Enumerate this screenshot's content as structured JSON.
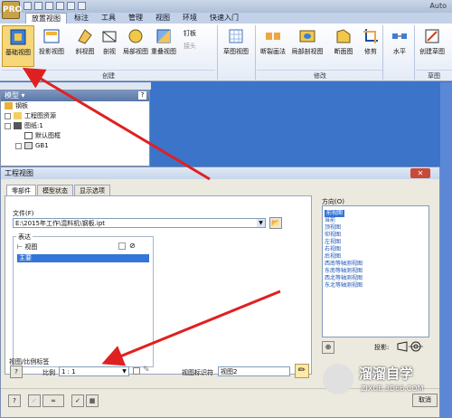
{
  "app": {
    "logo_label": "PRO",
    "title": "Auto"
  },
  "ribbon_tabs": [
    "放置视图",
    "标注",
    "工具",
    "管理",
    "视图",
    "环境",
    "快速入门"
  ],
  "ribbon": {
    "create_buttons": [
      "基础视图",
      "投影视图",
      "斜视图",
      "剖视",
      "局部视图",
      "重叠视图"
    ],
    "create_small": [
      "钉板",
      "接头"
    ],
    "sketch_button": "草图视图",
    "modify_buttons": [
      "断裂画法",
      "局部剖视图",
      "断面图",
      "修剪"
    ],
    "align_button": "水平",
    "sketch2_button": "创建草图",
    "groups": {
      "create": "创建",
      "modify": "修改",
      "sketch": "草图"
    }
  },
  "browser": {
    "title": "模型 ▾",
    "help": "?",
    "items": [
      "钢板",
      "工程图资源",
      "图纸:1",
      "默认图框",
      "GB1"
    ]
  },
  "dialog": {
    "title": "工程视图",
    "close": "✕",
    "tabs": [
      "零部件",
      "模型状态",
      "显示选项"
    ],
    "file_label": "文件(F)",
    "file_path": "E:\\2015年工作\\混料机\\钢板.ipt",
    "repr_label": "表达",
    "repr_header": "视图",
    "repr_selected": "主要",
    "orient_label": "方向(O)",
    "orient_items": [
      "前视图",
      "当前",
      "顶视图",
      "仰视图",
      "左视图",
      "右视图",
      "后视图",
      "西南等轴测视图",
      "东南等轴测视图",
      "西北等轴测视图",
      "东北等轴测视图"
    ],
    "projection_label": "投影:",
    "scale_section": "视图/比例标签",
    "scale_label": "比例",
    "scale_value": "1 : 1",
    "view_id_label": "视图标识符",
    "view_id_value": "视图2",
    "cancel": "取消"
  },
  "watermark": {
    "text": "溜溜自学",
    "sub": "ZIXUE.3D66.COM"
  }
}
